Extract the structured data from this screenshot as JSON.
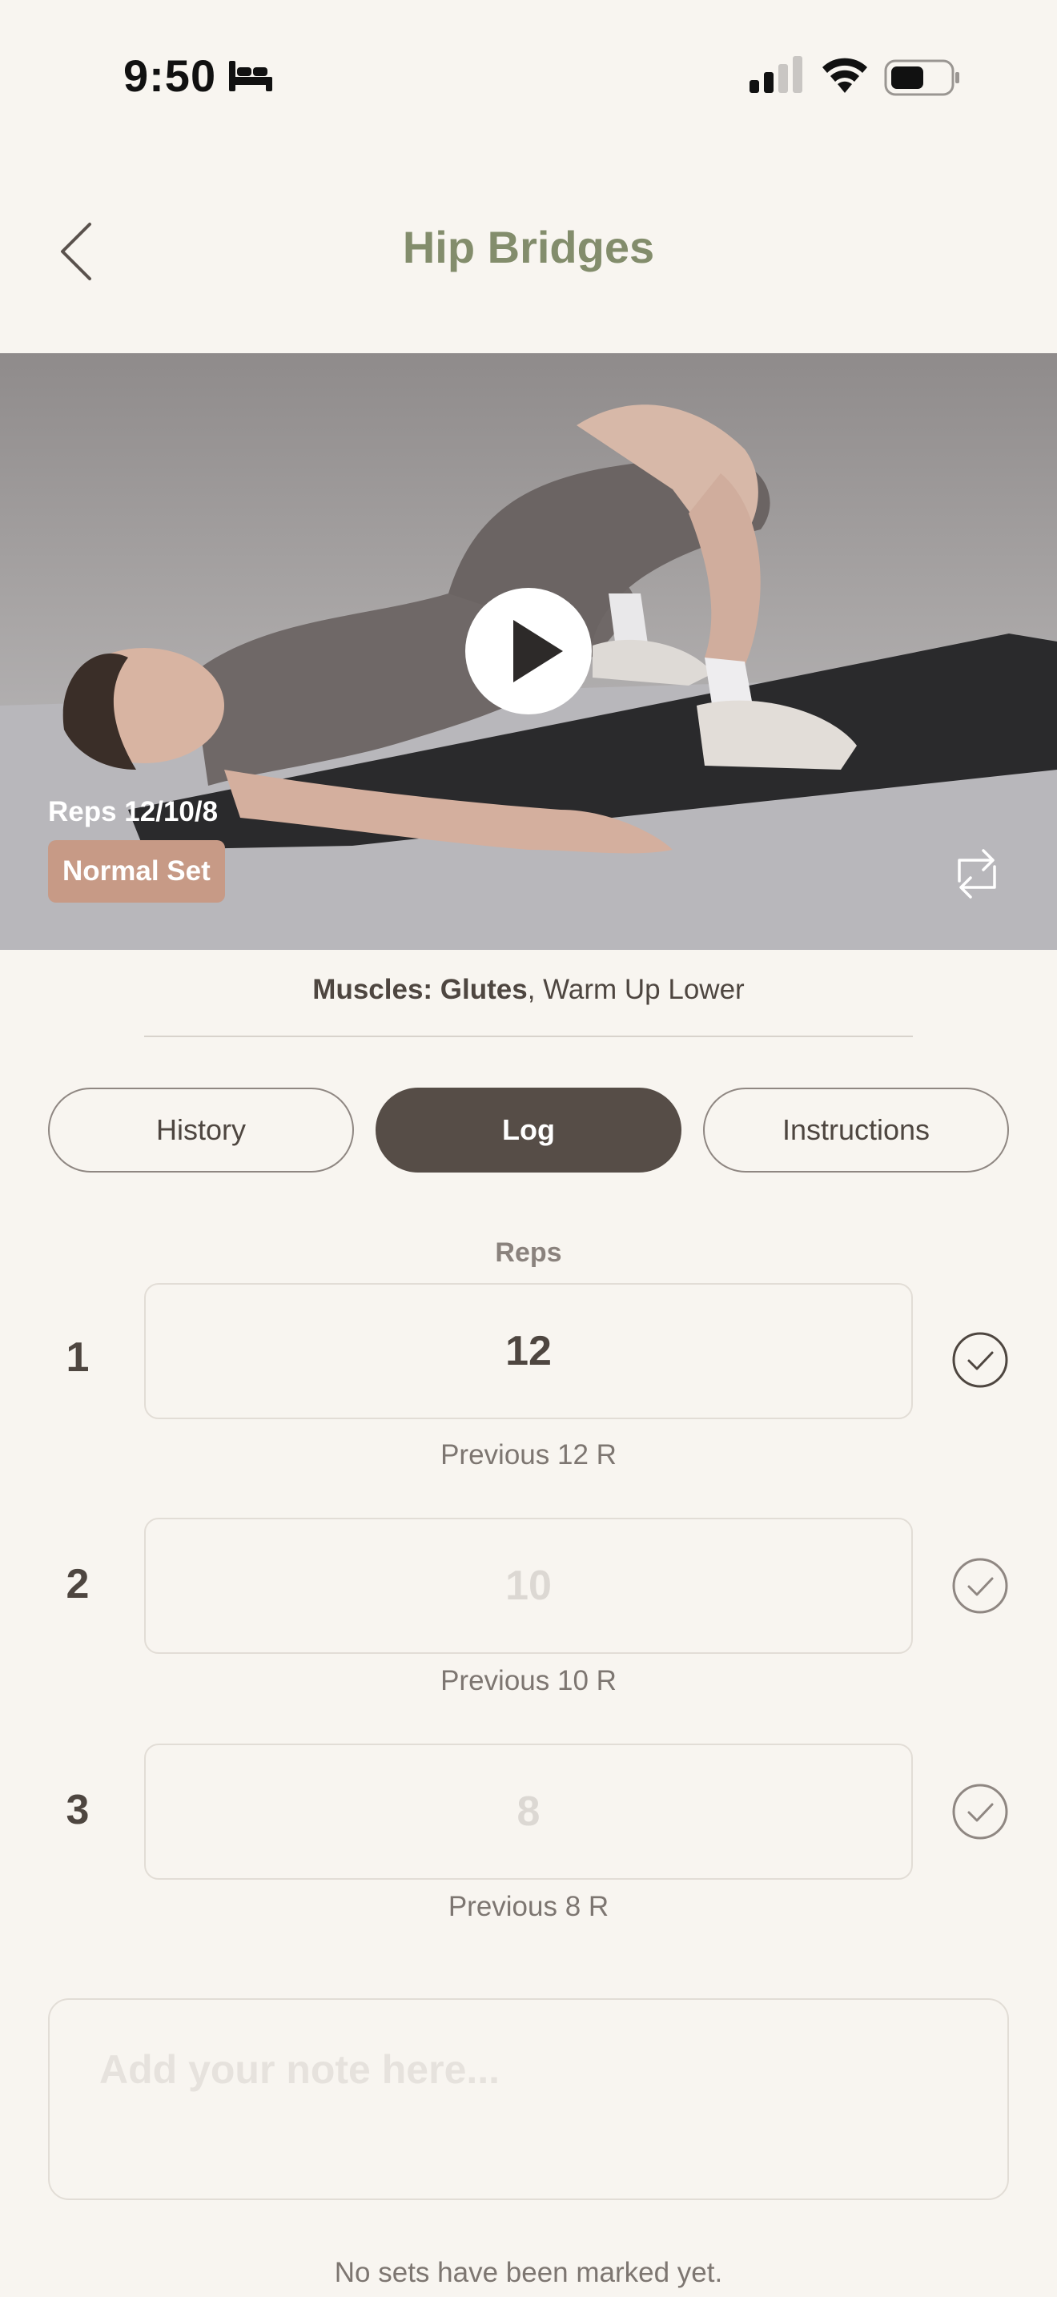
{
  "status_bar": {
    "time": "9:50",
    "icons": [
      "bed-icon",
      "signal-icon",
      "wifi-icon",
      "battery-icon"
    ]
  },
  "header": {
    "title": "Hip Bridges",
    "back_icon": "chevron-left-icon"
  },
  "video": {
    "reps_text": "Reps 12/10/8",
    "set_type": "Normal Set",
    "play_icon": "play-icon",
    "swap_icon": "swap-icon"
  },
  "muscles": {
    "label": "Muscles: Glutes",
    "extra": ", Warm Up Lower"
  },
  "tabs": [
    {
      "label": "History",
      "active": false
    },
    {
      "label": "Log",
      "active": true
    },
    {
      "label": "Instructions",
      "active": false
    }
  ],
  "sets_table": {
    "column_header": "Reps",
    "rows": [
      {
        "number": "1",
        "value": "12",
        "previous": "Previous 12 R",
        "filled": true
      },
      {
        "number": "2",
        "value": "10",
        "previous": "Previous 10 R",
        "filled": false
      },
      {
        "number": "3",
        "value": "8",
        "previous": "Previous 8 R",
        "filled": false
      }
    ]
  },
  "note": {
    "placeholder": "Add your note here..."
  },
  "footer": {
    "message": "No sets have been marked yet."
  },
  "colors": {
    "background": "#f8f5f0",
    "title_accent": "#838d6c",
    "active_tab": "#564d47",
    "badge": "#c79a86",
    "text": "#4e4640"
  }
}
